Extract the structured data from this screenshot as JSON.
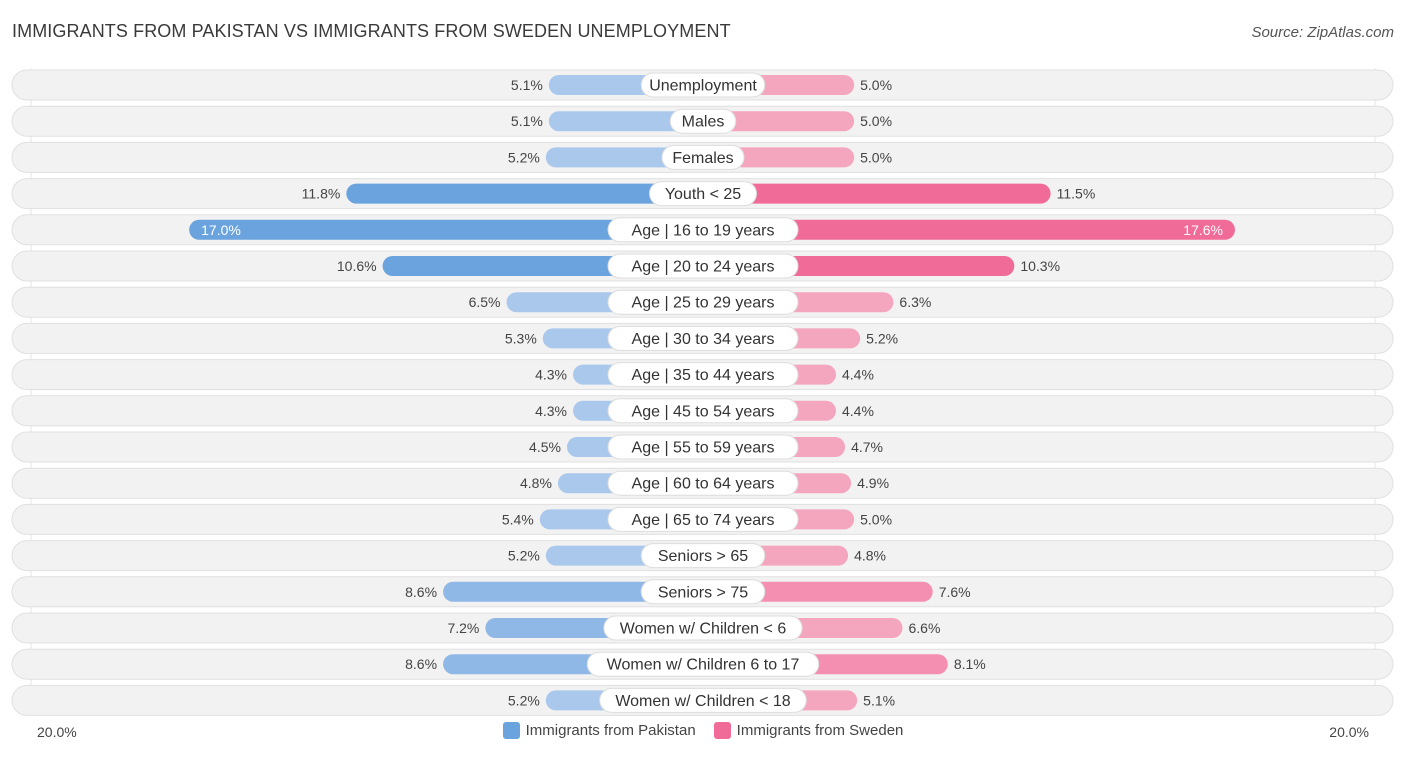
{
  "title": "IMMIGRANTS FROM PAKISTAN VS IMMIGRANTS FROM SWEDEN UNEMPLOYMENT",
  "source": "Source: ZipAtlas.com",
  "colors": {
    "pakistan": "#6aa3de",
    "pakistan_light": "#a9c8ec",
    "sweden": "#f06b97",
    "sweden_light": "#f5a6bf",
    "row_bg": "#f2f2f2"
  },
  "chart_data": {
    "type": "bar",
    "orientation": "horizontal-diverging",
    "title": "IMMIGRANTS FROM PAKISTAN VS IMMIGRANTS FROM SWEDEN UNEMPLOYMENT",
    "xlim": [
      -20,
      20
    ],
    "axis_labels": {
      "left": "20.0%",
      "right": "20.0%"
    },
    "legend_position": "bottom-center",
    "categories": [
      "Unemployment",
      "Males",
      "Females",
      "Youth < 25",
      "Age | 16 to 19 years",
      "Age | 20 to 24 years",
      "Age | 25 to 29 years",
      "Age | 30 to 34 years",
      "Age | 35 to 44 years",
      "Age | 45 to 54 years",
      "Age | 55 to 59 years",
      "Age | 60 to 64 years",
      "Age | 65 to 74 years",
      "Seniors > 65",
      "Seniors > 75",
      "Women w/ Children < 6",
      "Women w/ Children 6 to 17",
      "Women w/ Children < 18"
    ],
    "series": [
      {
        "name": "Immigrants from Pakistan",
        "side": "left",
        "values": [
          5.1,
          5.1,
          5.2,
          11.8,
          17.0,
          10.6,
          6.5,
          5.3,
          4.3,
          4.3,
          4.5,
          4.8,
          5.4,
          5.2,
          8.6,
          7.2,
          8.6,
          5.2
        ],
        "labels": [
          "5.1%",
          "5.1%",
          "5.2%",
          "11.8%",
          "17.0%",
          "10.6%",
          "6.5%",
          "5.3%",
          "4.3%",
          "4.3%",
          "4.5%",
          "4.8%",
          "5.4%",
          "5.2%",
          "8.6%",
          "7.2%",
          "8.6%",
          "5.2%"
        ]
      },
      {
        "name": "Immigrants from Sweden",
        "side": "right",
        "values": [
          5.0,
          5.0,
          5.0,
          11.5,
          17.6,
          10.3,
          6.3,
          5.2,
          4.4,
          4.4,
          4.7,
          4.9,
          5.0,
          4.8,
          7.6,
          6.6,
          8.1,
          5.1
        ],
        "labels": [
          "5.0%",
          "5.0%",
          "5.0%",
          "11.5%",
          "17.6%",
          "10.3%",
          "6.3%",
          "5.2%",
          "4.4%",
          "4.4%",
          "4.7%",
          "4.9%",
          "5.0%",
          "4.8%",
          "7.6%",
          "6.6%",
          "8.1%",
          "5.1%"
        ]
      }
    ]
  },
  "legend": [
    {
      "label": "Immigrants from Pakistan",
      "color": "#6aa3de"
    },
    {
      "label": "Immigrants from Sweden",
      "color": "#f06b97"
    }
  ]
}
